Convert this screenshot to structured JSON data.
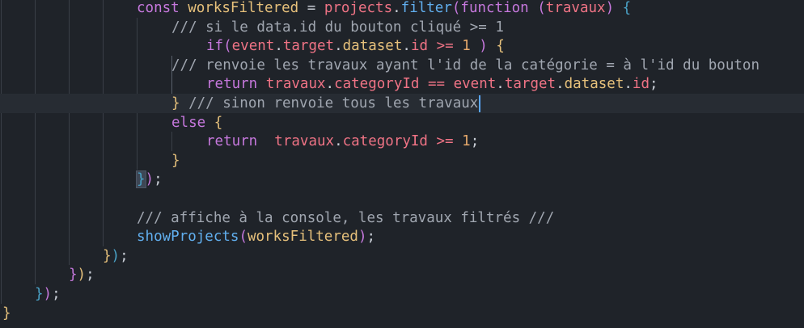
{
  "lines": [
    {
      "tokens": [
        {
          "t": "const",
          "c": "kw"
        },
        {
          "t": " ",
          "c": "plain"
        },
        {
          "t": "worksFiltered",
          "c": "var"
        },
        {
          "t": " = ",
          "c": "plain"
        },
        {
          "t": "projects",
          "c": "prop"
        },
        {
          "t": ".",
          "c": "plain"
        },
        {
          "t": "filter",
          "c": "fn"
        },
        {
          "t": "(",
          "c": "p2"
        },
        {
          "t": "function",
          "c": "kw"
        },
        {
          "t": " (",
          "c": "p2"
        },
        {
          "t": "travaux",
          "c": "prop"
        },
        {
          "t": ")",
          "c": "p2"
        },
        {
          "t": " ",
          "c": "plain"
        },
        {
          "t": "{",
          "c": "p3"
        }
      ]
    },
    {
      "tokens": [
        {
          "t": "/// si le data.id du bouton cliqué >= 1",
          "c": "cmt"
        }
      ]
    },
    {
      "tokens": [
        {
          "t": "if",
          "c": "kw"
        },
        {
          "t": "(",
          "c": "p2"
        },
        {
          "t": "event",
          "c": "prop"
        },
        {
          "t": ".",
          "c": "plain"
        },
        {
          "t": "target",
          "c": "prop"
        },
        {
          "t": ".",
          "c": "plain"
        },
        {
          "t": "dataset",
          "c": "var"
        },
        {
          "t": ".",
          "c": "plain"
        },
        {
          "t": "id",
          "c": "prop"
        },
        {
          "t": " ",
          "c": "plain"
        },
        {
          "t": ">=",
          "c": "op"
        },
        {
          "t": " ",
          "c": "plain"
        },
        {
          "t": "1",
          "c": "num"
        },
        {
          "t": " ",
          "c": "plain"
        },
        {
          "t": ")",
          "c": "p2"
        },
        {
          "t": " ",
          "c": "plain"
        },
        {
          "t": "{",
          "c": "p1"
        }
      ]
    },
    {
      "tokens": [
        {
          "t": "/// renvoie les travaux ayant l'id de la catégorie = à l'id du bouton",
          "c": "cmt"
        }
      ]
    },
    {
      "tokens": [
        {
          "t": "return",
          "c": "kw"
        },
        {
          "t": " ",
          "c": "plain"
        },
        {
          "t": "travaux",
          "c": "prop"
        },
        {
          "t": ".",
          "c": "plain"
        },
        {
          "t": "categoryId",
          "c": "prop"
        },
        {
          "t": " ",
          "c": "plain"
        },
        {
          "t": "==",
          "c": "op"
        },
        {
          "t": " ",
          "c": "plain"
        },
        {
          "t": "event",
          "c": "prop"
        },
        {
          "t": ".",
          "c": "plain"
        },
        {
          "t": "target",
          "c": "prop"
        },
        {
          "t": ".",
          "c": "plain"
        },
        {
          "t": "dataset",
          "c": "var"
        },
        {
          "t": ".",
          "c": "plain"
        },
        {
          "t": "id",
          "c": "prop"
        },
        {
          "t": ";",
          "c": "plain"
        }
      ]
    },
    {
      "tokens": [
        {
          "t": "}",
          "c": "p1"
        },
        {
          "t": " /// sinon renvoie tous les travaux",
          "c": "cmt"
        }
      ],
      "cursor": true
    },
    {
      "tokens": [
        {
          "t": "else",
          "c": "kw"
        },
        {
          "t": " ",
          "c": "plain"
        },
        {
          "t": "{",
          "c": "p1"
        }
      ]
    },
    {
      "tokens": [
        {
          "t": "return",
          "c": "kw"
        },
        {
          "t": "  ",
          "c": "plain"
        },
        {
          "t": "travaux",
          "c": "prop"
        },
        {
          "t": ".",
          "c": "plain"
        },
        {
          "t": "categoryId",
          "c": "prop"
        },
        {
          "t": " ",
          "c": "plain"
        },
        {
          "t": ">=",
          "c": "op"
        },
        {
          "t": " ",
          "c": "plain"
        },
        {
          "t": "1",
          "c": "num"
        },
        {
          "t": ";",
          "c": "plain"
        }
      ]
    },
    {
      "tokens": [
        {
          "t": "}",
          "c": "p1"
        }
      ]
    },
    {
      "tokens": [
        {
          "t": "}",
          "c": "p3"
        },
        {
          "t": ")",
          "c": "p2"
        },
        {
          "t": ";",
          "c": "plain"
        }
      ]
    },
    {
      "tokens": []
    },
    {
      "tokens": [
        {
          "t": "/// affiche à la console, les travaux filtrés ///",
          "c": "cmt"
        }
      ]
    },
    {
      "tokens": [
        {
          "t": "showProjects",
          "c": "fn"
        },
        {
          "t": "(",
          "c": "p2"
        },
        {
          "t": "worksFiltered",
          "c": "var"
        },
        {
          "t": ")",
          "c": "p2"
        },
        {
          "t": ";",
          "c": "plain"
        }
      ]
    },
    {
      "tokens": [
        {
          "t": "}",
          "c": "p1"
        },
        {
          "t": ")",
          "c": "p3"
        },
        {
          "t": ";",
          "c": "plain"
        }
      ]
    },
    {
      "tokens": [
        {
          "t": "}",
          "c": "p2"
        },
        {
          "t": ")",
          "c": "p1"
        },
        {
          "t": ";",
          "c": "plain"
        }
      ]
    },
    {
      "tokens": [
        {
          "t": "}",
          "c": "p3"
        },
        {
          "t": ")",
          "c": "p2"
        },
        {
          "t": ";",
          "c": "plain"
        }
      ]
    },
    {
      "tokens": [
        {
          "t": "}",
          "c": "p1"
        }
      ]
    }
  ]
}
